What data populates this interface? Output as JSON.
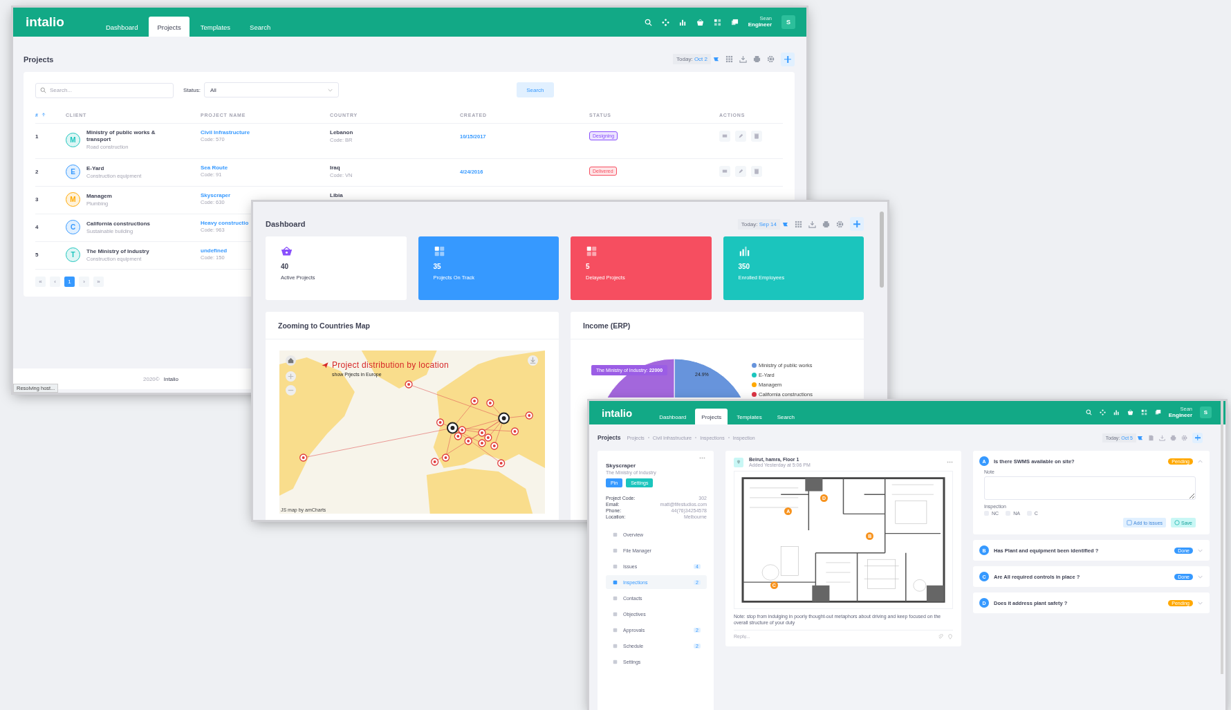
{
  "projects_window": {
    "header": {
      "logo": "intalio",
      "tabs": [
        {
          "label": "Dashboard",
          "selected": false
        },
        {
          "label": "Projects",
          "selected": true
        },
        {
          "label": "Templates",
          "selected": false
        },
        {
          "label": "Search",
          "selected": false
        }
      ],
      "user_name": "Sean",
      "user_role": "Engineer",
      "avatar": "S"
    },
    "title": "Projects",
    "today_label": "Today:",
    "today": "Oct 2",
    "search": {
      "placeholder": "Search..."
    },
    "status_label": "Status:",
    "status_value": "All",
    "search_button": "Search",
    "columns": [
      "#",
      "CLIENT",
      "PROJECT NAME",
      "COUNTRY",
      "CREATED",
      "STATUS",
      "ACTIONS"
    ],
    "rows": [
      {
        "index": "1",
        "initial": "M",
        "color": "#1bc5bd",
        "client": "Ministry of public works & transport",
        "client_type": "Road construction",
        "project": "Civil Infrastructure",
        "code": "Code: 570",
        "country": "Lebanon",
        "country_code": "Code: BR",
        "created": "10/15/2017",
        "status": {
          "text": "Designing",
          "color": "#8950fc"
        }
      },
      {
        "index": "2",
        "initial": "E",
        "color": "#3699ff",
        "client": "E-Yard",
        "client_type": "Construction equipment",
        "project": "Sea Route",
        "code": "Code: 91",
        "country": "Iraq",
        "country_code": "Code: VN",
        "created": "4/24/2016",
        "status": {
          "text": "Delivered",
          "color": "#f64e60"
        }
      },
      {
        "index": "3",
        "initial": "M",
        "color": "#ffa800",
        "client": "Managem",
        "client_type": "Plumbing",
        "project": "Skyscraper",
        "code": "Code: 630",
        "country": "Libia"
      },
      {
        "index": "4",
        "initial": "C",
        "color": "#3699ff",
        "client": "California constructions",
        "client_type": "Sustainable building",
        "project": "Heavy constructio",
        "code": "Code: 963"
      },
      {
        "index": "5",
        "initial": "T",
        "color": "#1bc5bd",
        "client": "The Ministry of Industry",
        "client_type": "Construction equipment",
        "project": "undefined",
        "code": "Code: 150"
      }
    ],
    "pagination": [
      {
        "label": "«",
        "selected": false
      },
      {
        "label": "‹",
        "selected": false
      },
      {
        "label": "1",
        "selected": true
      },
      {
        "label": "›",
        "selected": false
      },
      {
        "label": "»",
        "selected": false
      }
    ],
    "footer_year": "2020©",
    "footer_brand": "Intalio",
    "status_bar": "Resolving host..."
  },
  "dashboard_window": {
    "title": "Dashboard",
    "today_label": "Today:",
    "today": "Sep 14",
    "stats": [
      {
        "kind": "basket",
        "value": "40",
        "label": "Active Projects",
        "color": "#ffffff"
      },
      {
        "kind": "tiles",
        "value": "35",
        "label": "Projects On Track",
        "color": "#3699ff"
      },
      {
        "kind": "tiles",
        "value": "5",
        "label": "Delayed Projects",
        "color": "#f64e60"
      },
      {
        "kind": "bars",
        "value": "350",
        "label": "Enrolled Employees",
        "color": "#1bc5bd"
      }
    ],
    "map_panel": {
      "title": "Zooming to Countries Map",
      "heading": "Project distribution by location",
      "subheading": "show Prjects in Europe",
      "credit": "JS map by amCharts"
    },
    "income_panel": {
      "title": "Income (ERP)",
      "tooltip": "The Ministry of Industry: **22000**",
      "slice_label": "24.9%",
      "legend": [
        {
          "label": "Ministry of public works",
          "color": "#6794dc"
        },
        {
          "label": "E-Yard",
          "color": "#1bc5bd"
        },
        {
          "label": "Managem",
          "color": "#ffa800"
        },
        {
          "label": "California constructions",
          "color": "#dc3545"
        }
      ]
    }
  },
  "inspection_window": {
    "header": {
      "logo": "intalio",
      "tabs": [
        {
          "label": "Dashboard",
          "selected": false
        },
        {
          "label": "Projects",
          "selected": true
        },
        {
          "label": "Templates",
          "selected": false
        },
        {
          "label": "Search",
          "selected": false
        }
      ],
      "user_name": "Sean",
      "user_role": "Engineer",
      "avatar": "S"
    },
    "title": "Projects",
    "breadcrumb": [
      "Projects",
      "Civil Infrastructure",
      "Inspections",
      "Inspection"
    ],
    "today_label": "Today:",
    "today": "Oct 5",
    "project_card": {
      "name": "Skyscraper",
      "client": "The Ministry of Industry",
      "buttons": [
        {
          "label": "Pin",
          "kind": "primary"
        },
        {
          "label": "Settings",
          "kind": "teal"
        }
      ],
      "details": [
        {
          "label": "Project Code:",
          "value": "302"
        },
        {
          "label": "Email:",
          "value": "matt@fifestudios.com"
        },
        {
          "label": "Phone:",
          "value": "44(76)34254578"
        },
        {
          "label": "Location:",
          "value": "Melbourne"
        }
      ],
      "menu": [
        {
          "label": "Overview",
          "selected": false
        },
        {
          "label": "File Manager",
          "selected": false
        },
        {
          "label": "Issues",
          "badge": "4",
          "selected": false
        },
        {
          "label": "Inspections",
          "badge": "2",
          "selected": true
        },
        {
          "label": "Contacts",
          "selected": false
        },
        {
          "label": "Objectives",
          "selected": false
        },
        {
          "label": "Approvals",
          "badge": "2",
          "selected": false
        },
        {
          "label": "Schedule",
          "badge": "2",
          "selected": false
        },
        {
          "label": "Settings",
          "selected": false
        }
      ]
    },
    "post": {
      "location": "Beirut, hamra, Floor 1",
      "time": "Added Yesterday at 5:06 PM",
      "markers": [
        "A",
        "B",
        "C",
        "D"
      ],
      "note": "Note: stop from indulging in poorly thought-out metaphors about driving and keep focused on the overall structure of your duty",
      "reply_placeholder": "Reply..."
    },
    "questions": [
      {
        "letter": "A",
        "text": "Is there SWMS available on site?",
        "status": {
          "text": "Pending",
          "color": "#ffa800"
        },
        "expanded": true
      },
      {
        "letter": "B",
        "text": "Has Plant and equipment been identified ?",
        "status": {
          "text": "Done",
          "color": "#3699ff"
        },
        "expanded": false
      },
      {
        "letter": "C",
        "text": "Are All required controls in place ?",
        "status": {
          "text": "Done",
          "color": "#3699ff"
        },
        "expanded": false
      },
      {
        "letter": "D",
        "text": "Does it address plant safety ?",
        "status": {
          "text": "Pending",
          "color": "#ffa800"
        },
        "expanded": false
      }
    ],
    "note_label": "Note",
    "inspection_label": "Inspection",
    "options": [
      {
        "label": "NC",
        "checked": false
      },
      {
        "label": "NA",
        "checked": false
      },
      {
        "label": "C",
        "checked": false
      }
    ],
    "actions": [
      "Add to issues",
      "Save"
    ]
  }
}
